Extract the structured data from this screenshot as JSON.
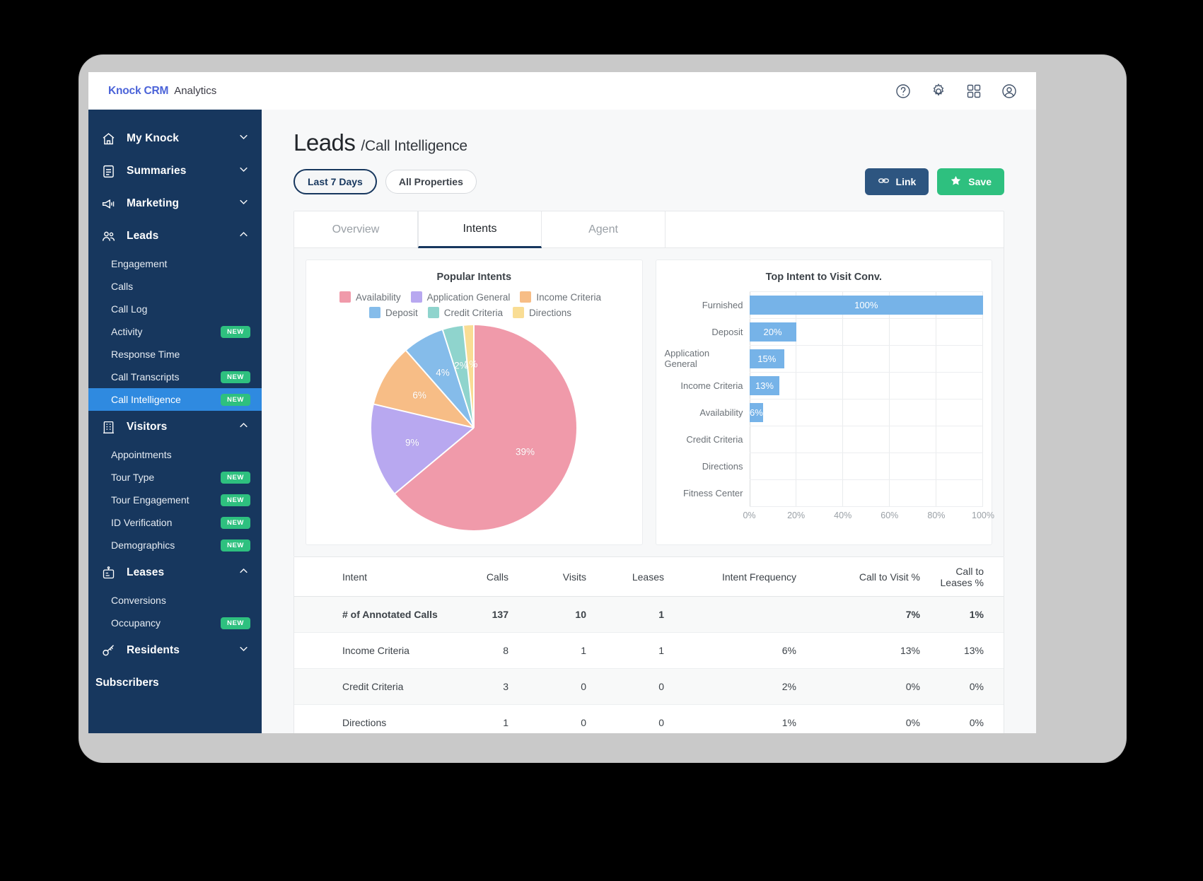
{
  "topbar": {
    "brand": "Knock CRM",
    "section": "Analytics",
    "icons": [
      "help-icon",
      "gear-icon",
      "apps-grid-icon",
      "account-icon"
    ]
  },
  "sidebar": {
    "groups": [
      {
        "label": "My Knock",
        "icon": "home-icon",
        "expanded": false,
        "children": []
      },
      {
        "label": "Summaries",
        "icon": "document-icon",
        "expanded": false,
        "children": []
      },
      {
        "label": "Marketing",
        "icon": "megaphone-icon",
        "expanded": false,
        "children": []
      },
      {
        "label": "Leads",
        "icon": "people-icon",
        "expanded": true,
        "children": [
          {
            "label": "Engagement",
            "badge": ""
          },
          {
            "label": "Calls",
            "badge": ""
          },
          {
            "label": "Call Log",
            "badge": ""
          },
          {
            "label": "Activity",
            "badge": "NEW"
          },
          {
            "label": "Response Time",
            "badge": ""
          },
          {
            "label": "Call Transcripts",
            "badge": "NEW"
          },
          {
            "label": "Call Intelligence",
            "badge": "NEW",
            "active": true
          }
        ]
      },
      {
        "label": "Visitors",
        "icon": "building-icon",
        "expanded": true,
        "children": [
          {
            "label": "Appointments",
            "badge": ""
          },
          {
            "label": "Tour Type",
            "badge": "NEW"
          },
          {
            "label": "Tour Engagement",
            "badge": "NEW"
          },
          {
            "label": "ID Verification",
            "badge": "NEW"
          },
          {
            "label": "Demographics",
            "badge": "NEW"
          }
        ]
      },
      {
        "label": "Leases",
        "icon": "lease-icon",
        "expanded": true,
        "children": [
          {
            "label": "Conversions",
            "badge": ""
          },
          {
            "label": "Occupancy",
            "badge": "NEW"
          }
        ]
      },
      {
        "label": "Residents",
        "icon": "key-icon",
        "expanded": false,
        "children": []
      }
    ],
    "footer_item": "Subscribers"
  },
  "page": {
    "title": "Leads",
    "subtitle": "/Call Intelligence",
    "filters": [
      {
        "label": "Last 7 Days",
        "style": "primary"
      },
      {
        "label": "All Properties",
        "style": "secondary"
      }
    ],
    "actions": [
      {
        "label": "Link",
        "icon": "link-icon",
        "color": "#2d5580"
      },
      {
        "label": "Save",
        "icon": "star-icon",
        "color": "#2ec07f"
      }
    ],
    "tabs": [
      {
        "label": "Overview",
        "active": false
      },
      {
        "label": "Intents",
        "active": true
      },
      {
        "label": "Agent",
        "active": false
      }
    ]
  },
  "chart_data": [
    {
      "type": "pie",
      "title": "Popular Intents",
      "legend_position": "top",
      "categories": [
        "Availability",
        "Application General",
        "Income Criteria",
        "Deposit",
        "Credit Criteria",
        "Directions"
      ],
      "values": [
        39,
        9,
        6,
        4,
        2,
        1
      ],
      "labels": [
        "39%",
        "9%",
        "6%",
        "4%",
        "2%",
        "1%"
      ],
      "colors": [
        "#f09aaa",
        "#b8a8f0",
        "#f7bd86",
        "#85bcea",
        "#8fd4cd",
        "#f9dd94"
      ]
    },
    {
      "type": "bar",
      "orientation": "horizontal",
      "title": "Top Intent to Visit Conv.",
      "categories": [
        "Furnished",
        "Deposit",
        "Application General",
        "Income Criteria",
        "Availability",
        "Credit Criteria",
        "Directions",
        "Fitness Center"
      ],
      "values": [
        100,
        20,
        15,
        13,
        6,
        0,
        0,
        0
      ],
      "labels": [
        "100%",
        "20%",
        "15%",
        "13%",
        "6%",
        "",
        "",
        ""
      ],
      "xlabel": "",
      "ylabel": "",
      "xlim": [
        0,
        100
      ],
      "xticks": [
        "0%",
        "20%",
        "40%",
        "60%",
        "80%",
        "100%"
      ],
      "grid": true,
      "bar_color": "#76b3e8"
    }
  ],
  "table": {
    "columns": [
      "Intent",
      "Calls",
      "Visits",
      "Leases",
      "Intent Frequency",
      "Call to Visit %",
      "Call to Leases %"
    ],
    "rows": [
      {
        "intent": "# of Annotated Calls",
        "calls": "137",
        "visits": "10",
        "leases": "1",
        "frequency": "",
        "call_to_visit": "7%",
        "call_to_leases": "1%",
        "bold": true
      },
      {
        "intent": "Income Criteria",
        "calls": "8",
        "visits": "1",
        "leases": "1",
        "frequency": "6%",
        "call_to_visit": "13%",
        "call_to_leases": "13%",
        "bold": false
      },
      {
        "intent": "Credit Criteria",
        "calls": "3",
        "visits": "0",
        "leases": "0",
        "frequency": "2%",
        "call_to_visit": "0%",
        "call_to_leases": "0%",
        "bold": false
      },
      {
        "intent": "Directions",
        "calls": "1",
        "visits": "0",
        "leases": "0",
        "frequency": "1%",
        "call_to_visit": "0%",
        "call_to_leases": "0%",
        "bold": false
      }
    ]
  }
}
